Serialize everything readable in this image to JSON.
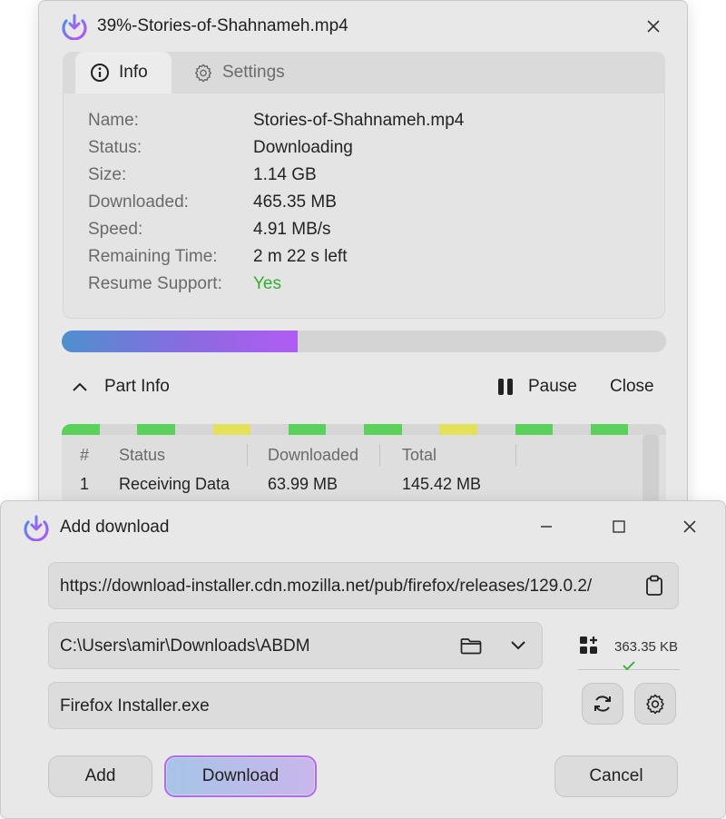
{
  "download_window": {
    "title": "39%-Stories-of-Shahnameh.mp4",
    "tabs": [
      {
        "label": "Info",
        "icon": "info-icon",
        "active": true
      },
      {
        "label": "Settings",
        "icon": "gear-icon",
        "active": false
      }
    ],
    "info": [
      {
        "label": "Name:",
        "value": "Stories-of-Shahnameh.mp4"
      },
      {
        "label": "Status:",
        "value": "Downloading"
      },
      {
        "label": "Size:",
        "value": "1.14 GB"
      },
      {
        "label": "Downloaded:",
        "value": "465.35 MB"
      },
      {
        "label": "Speed:",
        "value": "4.91 MB/s"
      },
      {
        "label": "Remaining Time:",
        "value": "2 m 22 s left"
      },
      {
        "label": "Resume Support:",
        "value": "Yes"
      }
    ],
    "progress_fraction": 0.39,
    "part_info_label": "Part Info",
    "pause_label": "Pause",
    "close_label": "Close",
    "segment_colors": [
      "#5ad15a",
      "#d6d6d6",
      "#5ad15a",
      "#d6d6d6",
      "#e3e05a",
      "#d6d6d6",
      "#5ad15a",
      "#d6d6d6",
      "#5ad15a",
      "#d6d6d6",
      "#e3e05a",
      "#d6d6d6",
      "#5ad15a",
      "#d6d6d6",
      "#5ad15a",
      "#d6d6d6"
    ],
    "parts_table": {
      "headers": [
        "#",
        "Status",
        "Downloaded",
        "Total"
      ],
      "rows": [
        {
          "num": "1",
          "status": "Receiving Data",
          "downloaded": "63.99 MB",
          "total": "145.42 MB"
        }
      ]
    }
  },
  "add_window": {
    "title": "Add download",
    "url": "https://download-installer.cdn.mozilla.net/pub/firefox/releases/129.0.2/",
    "path": "C:\\Users\\amir\\Downloads\\ABDM",
    "file_name": "Firefox Installer.exe",
    "size": "363.35 KB",
    "buttons": {
      "add": "Add",
      "download": "Download",
      "cancel": "Cancel"
    }
  },
  "colors": {
    "success": "#2fae2f",
    "accent": "#b06af0"
  }
}
